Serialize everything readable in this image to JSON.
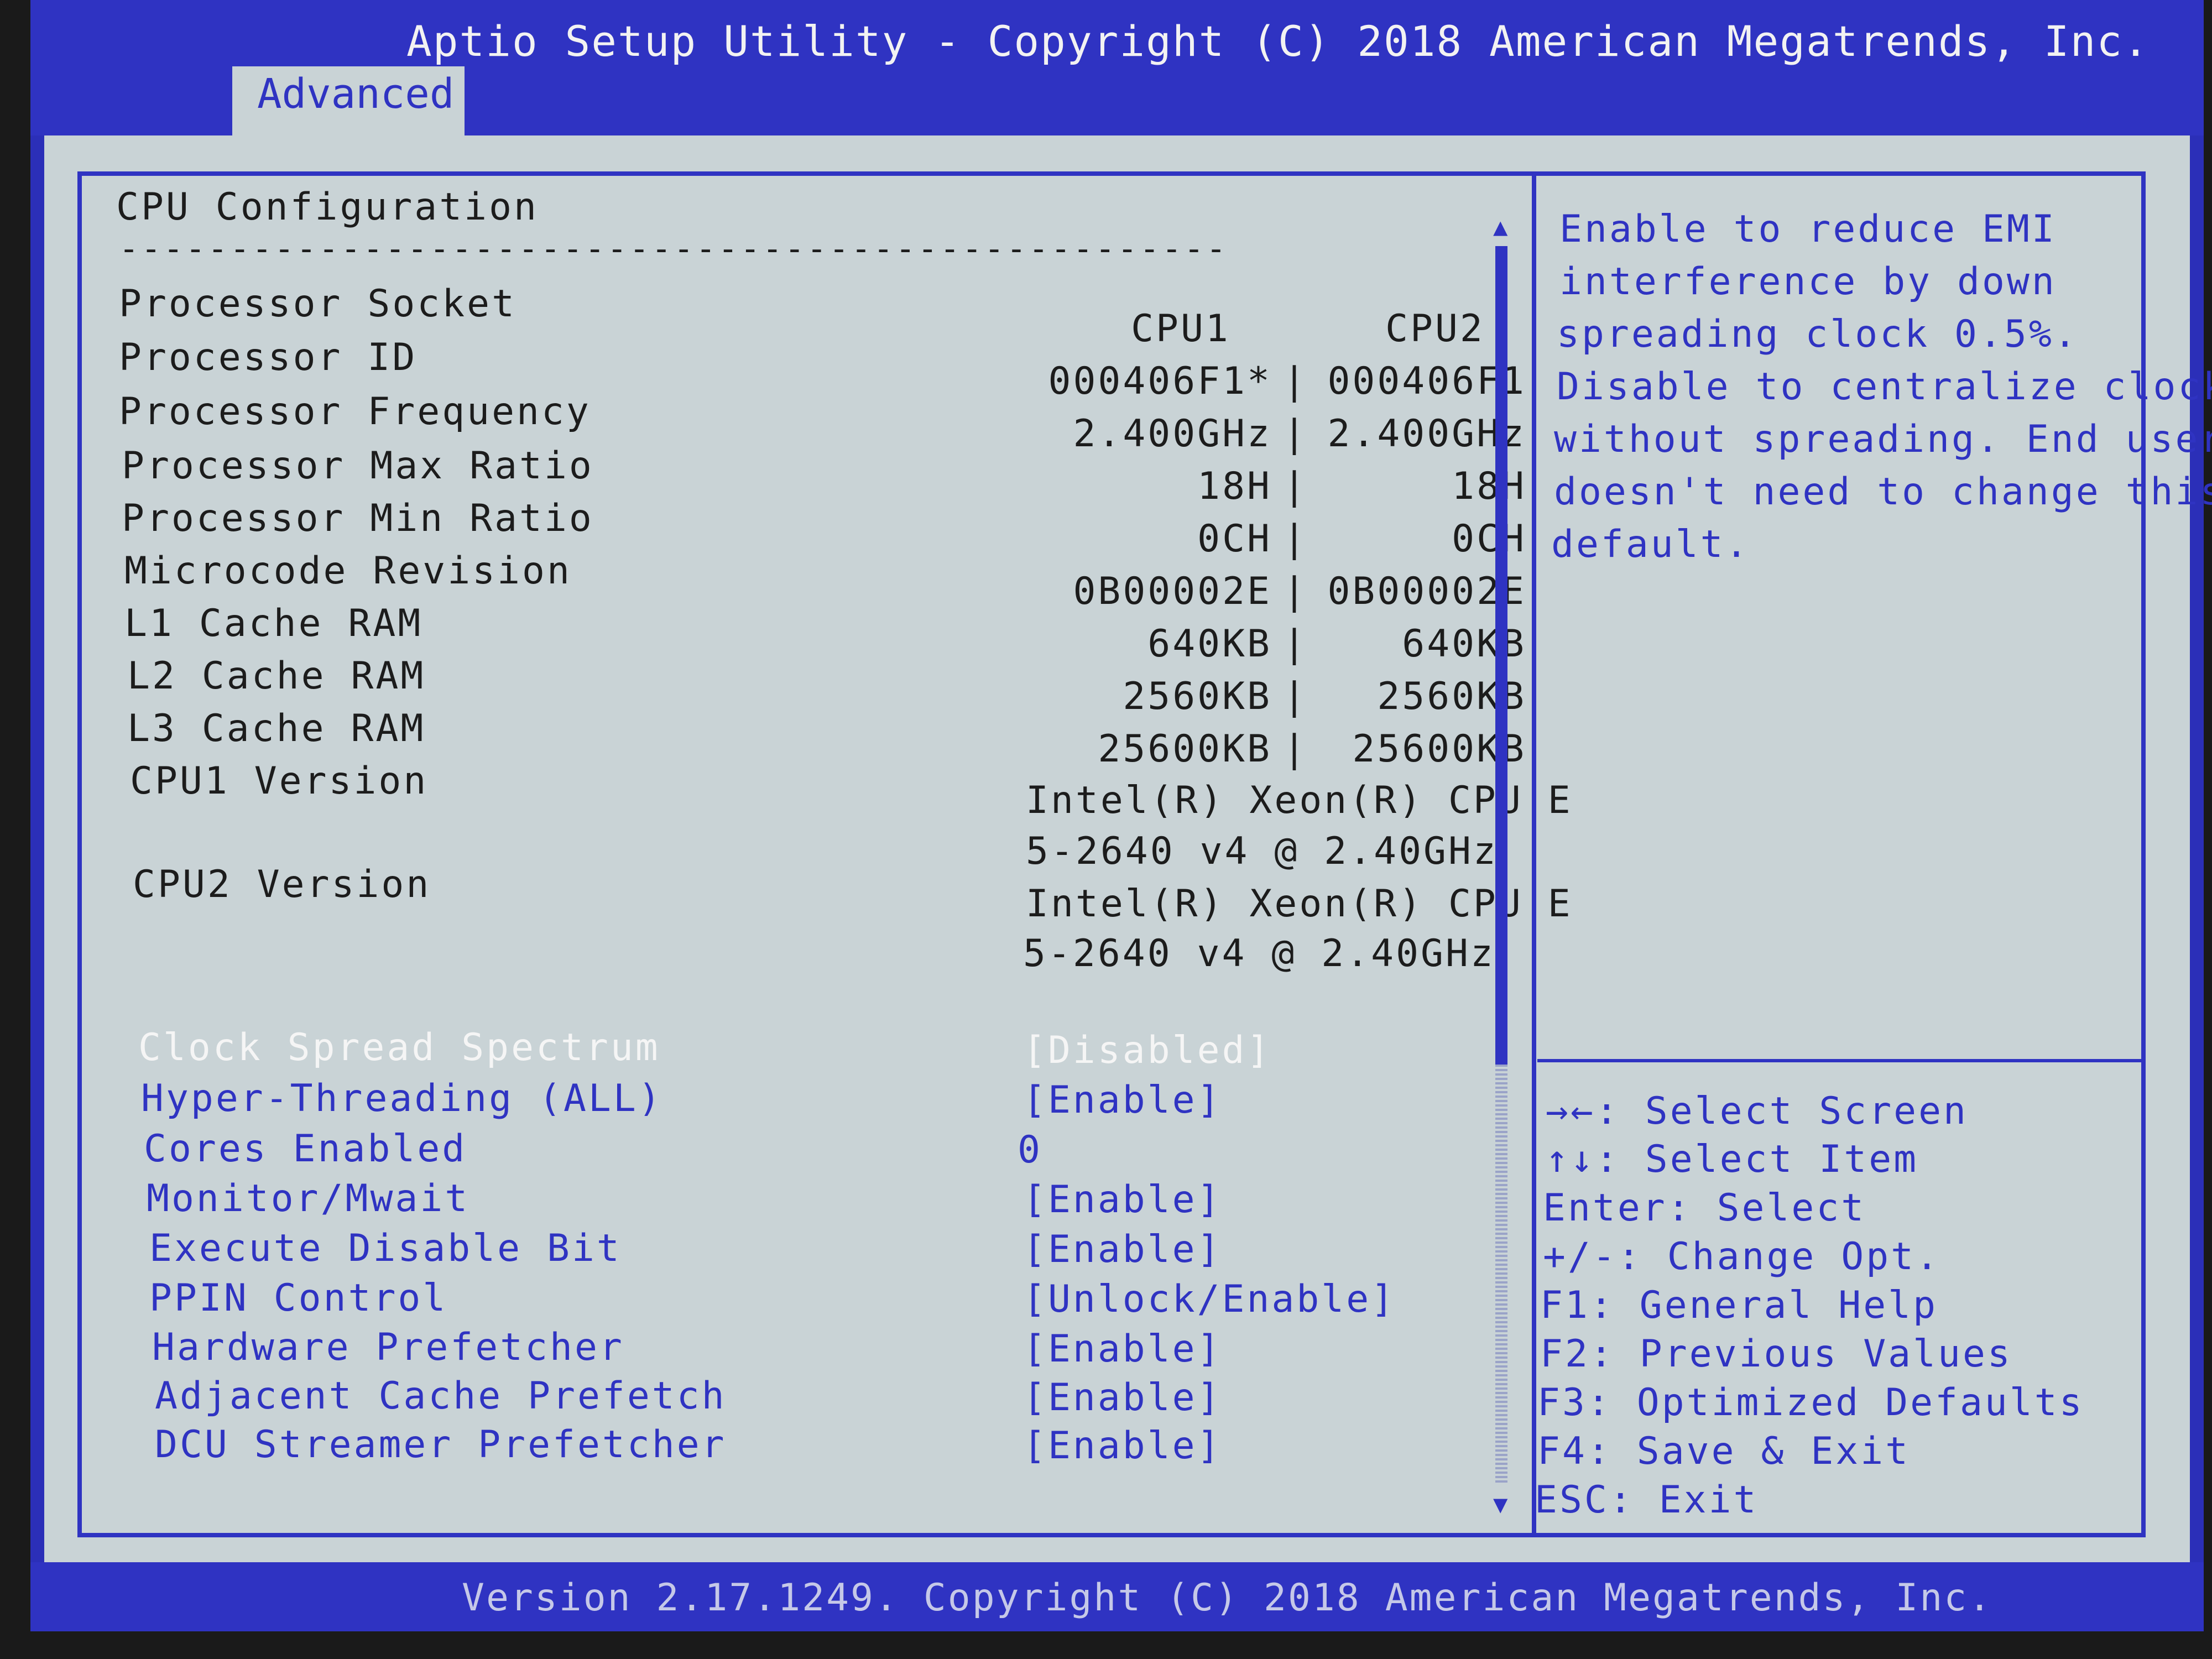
{
  "header": {
    "title": "Aptio Setup Utility - Copyright (C) 2018 American Megatrends, Inc.",
    "active_tab": "Advanced"
  },
  "section": {
    "title": "CPU Configuration",
    "separator": "--------------------------------------------------"
  },
  "info": {
    "col_headers": {
      "label": "Processor Socket",
      "cpu1": "CPU1",
      "cpu2": "CPU2"
    },
    "sep": "|",
    "rows": [
      {
        "label": "Processor ID",
        "cpu1": "000406F1*",
        "cpu2": "000406F1"
      },
      {
        "label": "Processor Frequency",
        "cpu1": "2.400GHz",
        "cpu2": "2.400GHz"
      },
      {
        "label": "Processor Max Ratio",
        "cpu1": "18H",
        "cpu2": "18H"
      },
      {
        "label": "Processor Min Ratio",
        "cpu1": "0CH",
        "cpu2": "0CH"
      },
      {
        "label": "Microcode Revision",
        "cpu1": "0B00002E",
        "cpu2": "0B00002E"
      },
      {
        "label": "L1 Cache RAM",
        "cpu1": "640KB",
        "cpu2": "640KB"
      },
      {
        "label": "L2 Cache RAM",
        "cpu1": "2560KB",
        "cpu2": "2560KB"
      },
      {
        "label": "L3 Cache RAM",
        "cpu1": "25600KB",
        "cpu2": "25600KB"
      }
    ],
    "cpu1_version": {
      "label": "CPU1 Version",
      "line1": "Intel(R) Xeon(R) CPU E",
      "line2": "5-2640 v4 @ 2.40GHz"
    },
    "cpu2_version": {
      "label": "CPU2 Version",
      "line1": "Intel(R) Xeon(R) CPU E",
      "line2": "5-2640 v4 @ 2.40GHz"
    }
  },
  "settings": [
    {
      "label": "Clock Spread Spectrum",
      "value": "[Disabled]",
      "selected": true
    },
    {
      "label": "Hyper-Threading (ALL)",
      "value": "[Enable]"
    },
    {
      "label": "Cores Enabled",
      "value": "0"
    },
    {
      "label": "Monitor/Mwait",
      "value": "[Enable]"
    },
    {
      "label": "Execute Disable Bit",
      "value": "[Enable]"
    },
    {
      "label": "PPIN Control",
      "value": "[Unlock/Enable]"
    },
    {
      "label": "Hardware Prefetcher",
      "value": "[Enable]"
    },
    {
      "label": "Adjacent Cache Prefetch",
      "value": "[Enable]"
    },
    {
      "label": "DCU Streamer Prefetcher",
      "value": "[Enable]"
    }
  ],
  "help": {
    "lines": [
      "Enable to reduce EMI",
      "interference by down",
      "spreading clock 0.5%.",
      "Disable to centralize clock",
      "without spreading. End user",
      "doesn't need to change this",
      "default."
    ]
  },
  "keys": [
    "→←: Select Screen",
    "↑↓: Select Item",
    "Enter: Select",
    "+/-: Change Opt.",
    "F1: General Help",
    "F2: Previous Values",
    "F3: Optimized Defaults",
    "F4: Save & Exit",
    "ESC: Exit"
  ],
  "footer": {
    "text": "Version 2.17.1249. Copyright (C) 2018 American Megatrends, Inc."
  },
  "colors": {
    "bios_blue": "#2f33c2",
    "panel_gray": "#c9d3d6",
    "text_dark": "#1c1c1c",
    "highlight_white": "#f5f5f5"
  },
  "icons": {
    "scroll_up": "triangle-up",
    "scroll_down": "triangle-down"
  }
}
